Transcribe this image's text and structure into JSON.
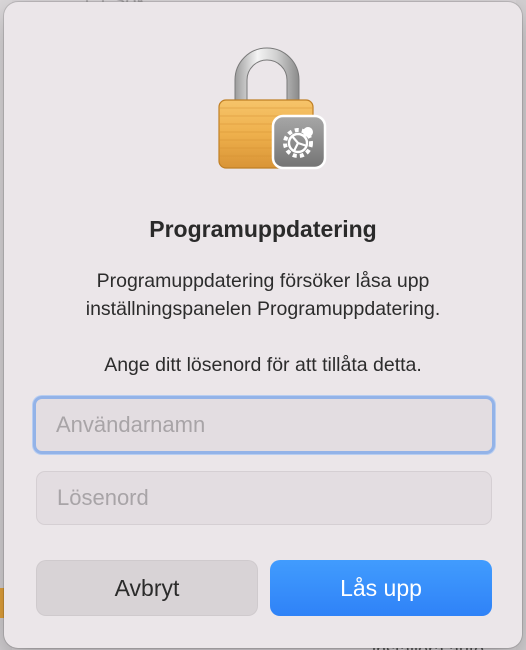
{
  "background": {
    "search_text": "Sök",
    "bottom_text": "installera auto"
  },
  "dialog": {
    "title": "Programuppdatering",
    "message": "Programuppdatering försöker låsa upp inställningspanelen Programuppdatering.",
    "prompt": "Ange ditt lösenord för att tillåta detta.",
    "username_placeholder": "Användarnamn",
    "password_placeholder": "Lösenord",
    "cancel_label": "Avbryt",
    "unlock_label": "Lås upp",
    "icon": "lock-with-gear-icon"
  },
  "colors": {
    "accent": "#3089f9",
    "focus_ring": "#93b3e8"
  }
}
